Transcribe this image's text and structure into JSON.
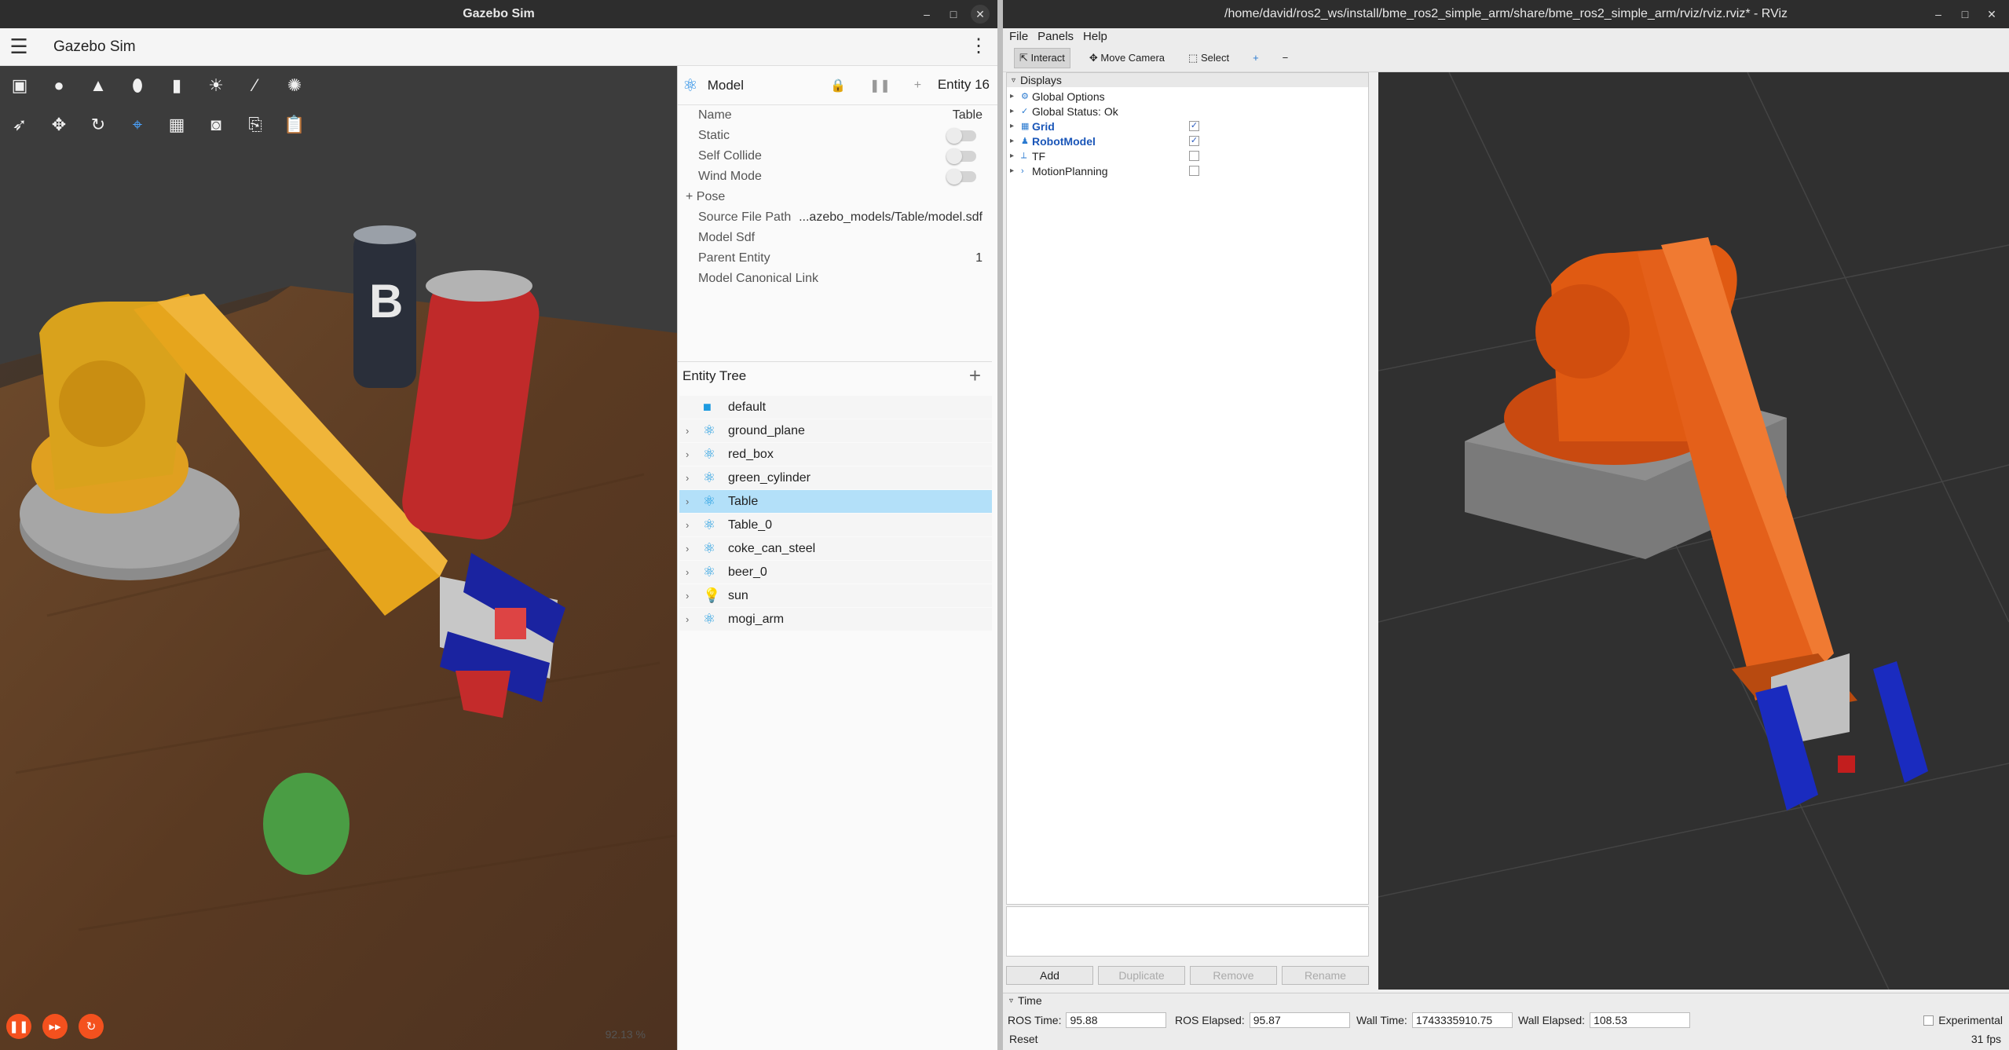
{
  "gazebo": {
    "window_title": "Gazebo Sim",
    "app_title": "Gazebo Sim",
    "menu_icon": "hamburger-icon",
    "more_icon": "more-vert-icon",
    "toolbar_row1": [
      "box-icon",
      "sphere-icon",
      "cone-icon",
      "cylinder-icon",
      "capsule-icon",
      "sun-icon",
      "directional-light-icon",
      "spot-light-icon"
    ],
    "toolbar_row2": [
      "select-icon",
      "translate-icon",
      "rotate-icon",
      "snap-icon",
      "grid-icon",
      "camera-icon",
      "copy-icon",
      "paste-icon"
    ],
    "play_controls": [
      "pause-icon",
      "step-icon",
      "reset-icon"
    ],
    "rtf": "92.13 %",
    "component": {
      "title": "Model",
      "entity": "Entity 16",
      "props": [
        {
          "label": "Name",
          "value": "Table"
        },
        {
          "label": "Static",
          "value": ""
        },
        {
          "label": "Self Collide",
          "value": ""
        },
        {
          "label": "Wind Mode",
          "value": ""
        },
        {
          "label": "+ Pose",
          "value": ""
        },
        {
          "label": "Source File Path",
          "value": "...azebo_models/Table/model.sdf"
        },
        {
          "label": "Model Sdf",
          "value": ""
        },
        {
          "label": "Parent Entity",
          "value": "1"
        },
        {
          "label": "Model Canonical Link",
          "value": ""
        }
      ]
    },
    "entity_tree": {
      "title": "Entity Tree",
      "items": [
        "default",
        "ground_plane",
        "red_box",
        "green_cylinder",
        "Table",
        "Table_0",
        "coke_can_steel",
        "beer_0",
        "sun",
        "mogi_arm"
      ]
    }
  },
  "rviz": {
    "window_title": "/home/david/ros2_ws/install/bme_ros2_simple_arm/share/bme_ros2_simple_arm/rviz/rviz.rviz* - RViz",
    "menus": [
      "File",
      "Panels",
      "Help"
    ],
    "tools": [
      "Interact",
      "Move Camera",
      "Select"
    ],
    "displays_title": "Displays",
    "displays": [
      {
        "label": "Global Options",
        "checked": null
      },
      {
        "label": "Global Status: Ok",
        "checked": null
      },
      {
        "label": "Grid",
        "checked": true
      },
      {
        "label": "RobotModel",
        "checked": true
      },
      {
        "label": "TF",
        "checked": false
      },
      {
        "label": "MotionPlanning",
        "checked": false
      }
    ],
    "buttons": [
      "Add",
      "Duplicate",
      "Remove",
      "Rename"
    ],
    "time": {
      "title": "Time",
      "ros_time_label": "ROS Time:",
      "ros_time": "95.88",
      "ros_elapsed_label": "ROS Elapsed:",
      "ros_elapsed": "95.87",
      "wall_time_label": "Wall Time:",
      "wall_time": "1743335910.75",
      "wall_elapsed_label": "Wall Elapsed:",
      "wall_elapsed": "108.53",
      "reset": "Reset",
      "experimental": "Experimental",
      "fps": "31 fps"
    }
  }
}
